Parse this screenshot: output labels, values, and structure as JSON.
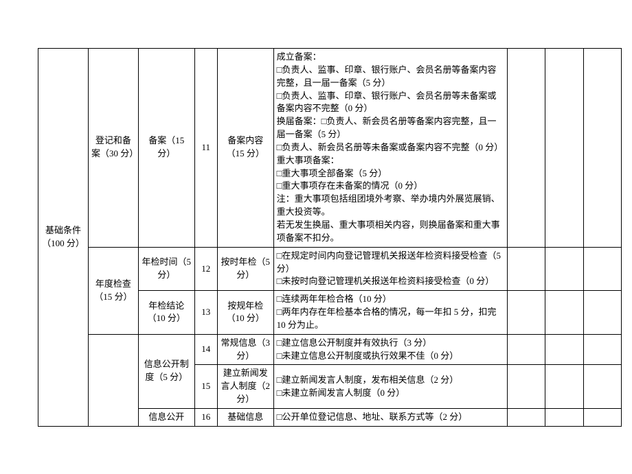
{
  "col_a": "基础条件（100 分）",
  "rows": [
    {
      "b": "登记和备案（30 分）",
      "c": "备案（15 分）",
      "d": "11",
      "e": "备案内容（15 分）",
      "f": "成立备案：\n□负责人、监事、印章、银行账户、会员名册等备案内容完整，且一届一备案（5 分）\n□负责人、监事、印章、银行账户、会员名册等未备案或备案内容不完整（0 分）\n换届备案：□负责人、新会员名册等备案内容完整，且一届一备案（5 分）\n□负责人、新会员名册等未备案或备案内容不完整（0 分）\n重大事项备案：\n□重大事项全部备案（5 分）\n□重大事项存在未备案的情况（0 分）\n注：重大事项包括组团境外考察、举办境内外展览展销、重大投资等。\n若无发生换届、重大事项相关内容，则换届备案和重大事项备案不扣分。"
    },
    {
      "b": "年度检查（15 分）",
      "c": "年检时间（5 分）",
      "d": "12",
      "e": "按时年检（5 分）",
      "f": "□在规定时间内向登记管理机关报送年检资料接受检查（5 分）\n□未按时向登记管理机关报送年检资料接受检查（0 分）"
    },
    {
      "c": "年检结论（10 分）",
      "d": "13",
      "e": "按规年检（10 分）",
      "f": "□连续两年年检合格（10 分）\n□两年内存在年检基本合格的情况，每一年扣 5 分，扣完 10 分为止。"
    },
    {
      "c": "信息公开制度（5 分）",
      "d": "14",
      "e": "常规信息（3 分）",
      "f": "□建立信息公开制度并有效执行（3 分）\n□未建立信息公开制度或执行效果不佳（0 分）"
    },
    {
      "d": "15",
      "e": "建立新闻发言人制度（2 分）",
      "f": "□建立新闻发言人制度，发布相关信息（2 分）\n□未建立新闻发言人制度（0 分）"
    },
    {
      "c": "信息公开",
      "d": "16",
      "e": "基础信息",
      "f": "□公开单位登记信息、地址、联系方式等（2 分）"
    }
  ]
}
